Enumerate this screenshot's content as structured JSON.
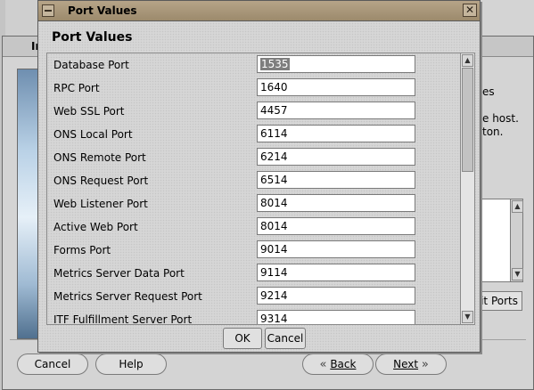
{
  "background_window": {
    "title": "In",
    "side_texts": [
      "es",
      "e host.",
      "ton."
    ],
    "edit_ports_button": "it Ports",
    "buttons": {
      "cancel": "Cancel",
      "help": "Help",
      "back": "Back",
      "next": "Next"
    }
  },
  "dialog": {
    "title": "Port Values",
    "heading": "Port Values",
    "close_glyph": "✕",
    "ports": [
      {
        "label": "Database Port",
        "value": "1535",
        "selected": true
      },
      {
        "label": "RPC Port",
        "value": "1640"
      },
      {
        "label": "Web SSL Port",
        "value": "4457"
      },
      {
        "label": "ONS Local Port",
        "value": "6114"
      },
      {
        "label": "ONS Remote Port",
        "value": "6214"
      },
      {
        "label": "ONS Request Port",
        "value": "6514"
      },
      {
        "label": "Web Listener Port",
        "value": "8014"
      },
      {
        "label": "Active Web Port",
        "value": "8014"
      },
      {
        "label": "Forms Port",
        "value": "9014"
      },
      {
        "label": "Metrics Server Data Port",
        "value": "9114"
      },
      {
        "label": "Metrics Server Request Port",
        "value": "9214"
      },
      {
        "label": "ITF Fulfillment Server Port",
        "value": "9314"
      }
    ],
    "scrollbar": {
      "position": 0.0,
      "visible_fraction": 0.43
    },
    "ok_label": "OK",
    "cancel_label": "Cancel"
  },
  "colors": {
    "dialog_title_bar": "#a8967a",
    "selection": "#7e7e7e"
  }
}
